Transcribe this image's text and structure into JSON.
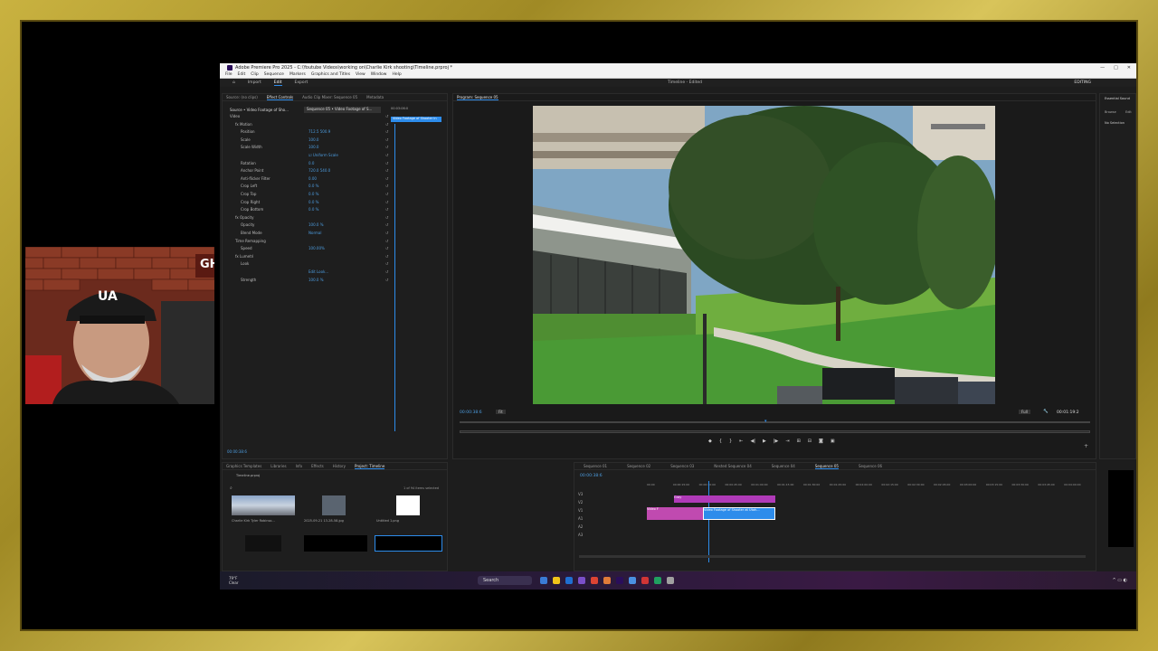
{
  "titlebar": {
    "title": "Adobe Premiere Pro 2025 - C:\\Youtube Videos\\working on\\Charlie Kirk shooting\\Timeline.prproj *",
    "controls": [
      "—",
      "□",
      "✕"
    ]
  },
  "menubar": {
    "items": [
      "File",
      "Edit",
      "Clip",
      "Sequence",
      "Markers",
      "Graphics and Titles",
      "View",
      "Window",
      "Help"
    ]
  },
  "workspace": {
    "tabs": [
      "Import",
      "Edit",
      "Export"
    ],
    "active": "Edit",
    "center_title": "Timeline - Edited",
    "right_label": "EDITING"
  },
  "source_panel": {
    "tabs": [
      "Source: (no clips)",
      "Effect Controls",
      "Audio Clip Mixer: Sequence 05",
      "Metadata"
    ],
    "active_tab": "Effect Controls",
    "source_selector": "Source • Video Footage of Sho...",
    "sequence_selector": "Sequence 05 • Video Footage of S...",
    "clip_label": "Video Footage of Shooter in",
    "timecode_top": "00:03:06:0",
    "rows": [
      {
        "label": "Video",
        "value": "",
        "indent": 0
      },
      {
        "label": "fx  Motion",
        "value": "",
        "indent": 1
      },
      {
        "label": "Position",
        "value": "712.5    500.9",
        "indent": 2
      },
      {
        "label": "Scale",
        "value": "100.0",
        "indent": 2
      },
      {
        "label": "Scale Width",
        "value": "100.0",
        "indent": 2
      },
      {
        "label": "",
        "value": "☑ Uniform Scale",
        "indent": 2
      },
      {
        "label": "Rotation",
        "value": "0.0",
        "indent": 2
      },
      {
        "label": "Anchor Point",
        "value": "720.0    540.0",
        "indent": 2
      },
      {
        "label": "Anti-flicker Filter",
        "value": "0.00",
        "indent": 2
      },
      {
        "label": "Crop Left",
        "value": "0.0 %",
        "indent": 2
      },
      {
        "label": "Crop Top",
        "value": "0.0 %",
        "indent": 2
      },
      {
        "label": "Crop Right",
        "value": "0.0 %",
        "indent": 2
      },
      {
        "label": "Crop Bottom",
        "value": "0.0 %",
        "indent": 2
      },
      {
        "label": "fx  Opacity",
        "value": "",
        "indent": 1
      },
      {
        "label": "Opacity",
        "value": "100.0 %",
        "indent": 2
      },
      {
        "label": "Blend Mode",
        "value": "Normal",
        "indent": 2
      },
      {
        "label": "Time Remapping",
        "value": "",
        "indent": 1
      },
      {
        "label": "Speed",
        "value": "100.00%",
        "indent": 2
      },
      {
        "label": "fx  Lumetri",
        "value": "",
        "indent": 1
      },
      {
        "label": "Look",
        "value": "",
        "indent": 2
      },
      {
        "label": "",
        "value": "Edit Look...",
        "indent": 2
      },
      {
        "label": "Strength",
        "value": "100.0 %",
        "indent": 2
      }
    ],
    "timecode_bottom": "00:00:38:6"
  },
  "program_monitor": {
    "tab": "Program: Sequence 05",
    "timecode_left": "00:00:38:6",
    "zoom": "Fit",
    "resolution": "Full",
    "timecode_right": "00:01:19:2"
  },
  "project_panel": {
    "tabs": [
      "Graphics Templates",
      "Libraries",
      "Info",
      "Effects",
      "History",
      "Project: Timeline"
    ],
    "active_tab": "Project: Timeline",
    "project_name": "Timeline.prproj",
    "items_selected": "1 of 94 items selected",
    "thumbs": [
      {
        "caption": "Charlie Kirk Tyler Robinso...",
        "duration": "2:11:00"
      },
      {
        "caption": "2025-09-21 13-28-58.jpg",
        "duration": "5:00"
      },
      {
        "caption": "Untitled 1.png",
        "duration": "5:00"
      }
    ]
  },
  "timeline": {
    "tabs": [
      "Sequence 01",
      "Sequence 02",
      "Sequence 03",
      "Nested Sequence 04",
      "Sequence 04",
      "Sequence 05",
      "Sequence 06"
    ],
    "active_tab": "Sequence 05",
    "timecode": "00:00:38:6",
    "ruler": [
      "00:00",
      "00:00:15:00",
      "00:00:30:00",
      "00:00:45:00",
      "00:01:00:00",
      "00:01:15:00",
      "00:01:30:00",
      "00:01:45:00",
      "00:02:00:00",
      "00:02:15:00",
      "00:02:30:00",
      "00:02:45:00",
      "00:03:00:00",
      "00:03:15:00",
      "00:03:30:00",
      "00:03:45:00",
      "00:04:00:00"
    ],
    "tracks": [
      "V3",
      "V2",
      "V1",
      "A1",
      "A2",
      "A3"
    ],
    "clips": [
      {
        "label": "Gray",
        "track": "V2"
      },
      {
        "label": "Video F",
        "track": "V1"
      },
      {
        "label": "Video Footage of Shooter at Utah...",
        "track": "V1"
      }
    ]
  },
  "essential_sound": {
    "tabs": [
      "Browse",
      "Edit"
    ],
    "title": "Essential Sound",
    "no_selection": "No Selection"
  },
  "taskbar": {
    "weather_temp": "79°F",
    "weather_desc": "Clear",
    "search_placeholder": "Search"
  },
  "webcam": {
    "shirt_logo": "UA",
    "sign_text": "GH"
  }
}
